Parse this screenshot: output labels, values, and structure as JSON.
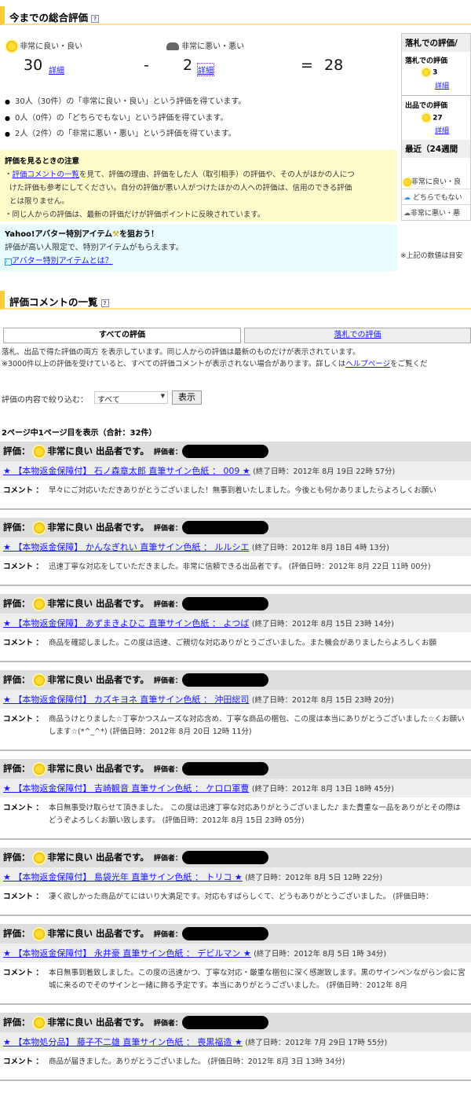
{
  "summary": {
    "title": "今までの総合評価",
    "help": "?",
    "good_label": "非常に良い・良い",
    "bad_label": "非常に悪い・悪い",
    "good": "30",
    "bad": "2",
    "minus": "-",
    "equals": "=",
    "total": "28",
    "detail": "詳細",
    "bullets": [
      "30人（30件）の「非常に良い・良い」という評価を得ています。",
      "0人（0件）の「どちらでもない」という評価を得ています。",
      "2人（2件）の「非常に悪い・悪い」という評価を得ています。"
    ]
  },
  "note": {
    "title": "評価を見るときの注意",
    "link": "評価コメントの一覧",
    "line1": "を見て、評価の理由、評価をした人（取引相手）の評価や、その人がほかの人につ",
    "line2": "けた評価も参考にしてください。自分の評価が悪い人がつけたほかの人への評価は、信用のできる評価",
    "line3": "とは限りません。",
    "line4": "・同じ人からの評価は、最新の評価だけが評価ポイントに反映されています。",
    "dot": "・"
  },
  "avatar": {
    "title_a": "Yahoo!アバター特別アイテム",
    "title_b": "を狙おう！",
    "desc": "評価が高い人限定で、特別アイテムがもらえます。",
    "link": "アバター特別アイテムとは？"
  },
  "side": {
    "title": "落札での評価/",
    "buy_label": "落札での評価",
    "buy": "3",
    "sell_label": "出品での評価",
    "sell": "27",
    "detail": "詳細",
    "recent": "最近（24週間",
    "good": "非常に良い・良",
    "neutral": "どちらでもない",
    "bad": "非常に悪い・悪",
    "footnote": "※上記の数値は目安"
  },
  "list": {
    "title": "評価コメントの一覧",
    "tab_all": "すべての評価",
    "tab_buy": "落札での評価",
    "desc1": "落札、出品で得た評価の両方 を表示しています。同じ人からの評価は最新のものだけが表示されています。",
    "desc2a": "※3000件以上の評価を受けていると、すべての評価コメントが表示されない場合があります。詳しくは",
    "desc2link": "ヘルプページ",
    "desc2b": "をご覧くだ",
    "filter_label": "評価の内容で絞り込む：",
    "filter_value": "すべて",
    "show": "表示",
    "page_info": "2ページ中1ページ目を表示（合計：32件）"
  },
  "entry_labels": {
    "rating": "評価：",
    "rater": "評価者：",
    "comment": "コメント",
    "colon": "："
  },
  "entries": [
    {
      "rating": "非常に良い 出品者です。",
      "title": "★ 【本物返金保障付】 石ノ森章太郎 直筆サイン色紙 ： 009 ★",
      "end": "(終了日時：2012年 8月 19日 22時 57分)",
      "c1": "早々にご対応いただきありがとうございました！無事到着いたしました。今後とも何かありましたらよろしくお願い",
      "c2": ""
    },
    {
      "rating": "非常に良い 出品者です。",
      "title": "★ 【本物返金保障】 かんなぎれい 直筆サイン色紙 ： ルルシエ",
      "end": "(終了日時：2012年 8月 18日 4時 13分)",
      "c1": "迅速丁寧な対応をしていただきました。非常に信頼できる出品者です。 (評価日時：2012年 8月 22日 11時 00分)",
      "c2": ""
    },
    {
      "rating": "非常に良い 出品者です。",
      "title": "★ 【本物返金保障】 あずまきよひこ 直筆サイン色紙 ： よつば",
      "end": "(終了日時：2012年 8月 15日 23時 14分)",
      "c1": "商品を確認しました。この度は迅速、ご親切な対応ありがとうございました。また機会がありましたらよろしくお願",
      "c2": ""
    },
    {
      "rating": "非常に良い 出品者です。",
      "title": "★ 【本物返金保障付】 カズキヨネ 直筆サイン色紙 ： 沖田総司",
      "end": "(終了日時：2012年 8月 15日 23時 20分)",
      "c1": "商品うけとりました☆丁寧かつスムーズな対応含め、丁寧な商品の梱包、この度は本当にありがとうございました☆",
      "c2": "くお願いします☆(*^_^*) (評価日時：2012年 8月 20日 12時 11分)"
    },
    {
      "rating": "非常に良い 出品者です。",
      "title": "★ 【本物返金保障付】 吉崎観音 直筆サイン色紙 ： ケロロ軍曹",
      "end": "(終了日時：2012年 8月 13日 18時 45分)",
      "c1": "本日無事受け取らせて頂きました。 この度は迅速丁寧な対応ありがとうございました♪ また貴重な一品をありがと",
      "c2": "その際はどうぞよろしくお願い致します。 (評価日時：2012年 8月 15日 23時 05分)"
    },
    {
      "rating": "非常に良い 出品者です。",
      "title": "★ 【本物返金保障付】 島袋光年 直筆サイン色紙 ： トリコ ★",
      "end": "(終了日時：2012年 8月 5日 12時 22分)",
      "c1": "凄く欲しかった商品がてにはいり大満足です。対応もすばらしくて、どうもありがとうございました。 (評価日時：",
      "c2": ""
    },
    {
      "rating": "非常に良い 出品者です。",
      "title": "★ 【本物返金保障付】 永井豪 直筆サイン色紙 ： デビルマン ★",
      "end": "(終了日時：2012年 8月 5日 1時 34分)",
      "c1": "本日無事到着致しました。この度の迅速かつ、丁寧な対応・厳重な梱包に深く感謝致します。黒のサインペンながら",
      "c2": "ン会に宮城に来るのでそのサインと一緒に飾る予定です。本当にありがとうございました。 (評価日時：2012年 8月"
    },
    {
      "rating": "非常に良い 出品者です。",
      "title": "★ 【本物処分品】 藤子不二雄 直筆サイン色紙 ： 喪黒福造 ★",
      "end": "(終了日時：2012年 7月 29日 17時 55分)",
      "c1": "商品が届きました。ありがとうございました。 (評価日時：2012年 8月 3日 13時 34分)",
      "c2": ""
    }
  ]
}
